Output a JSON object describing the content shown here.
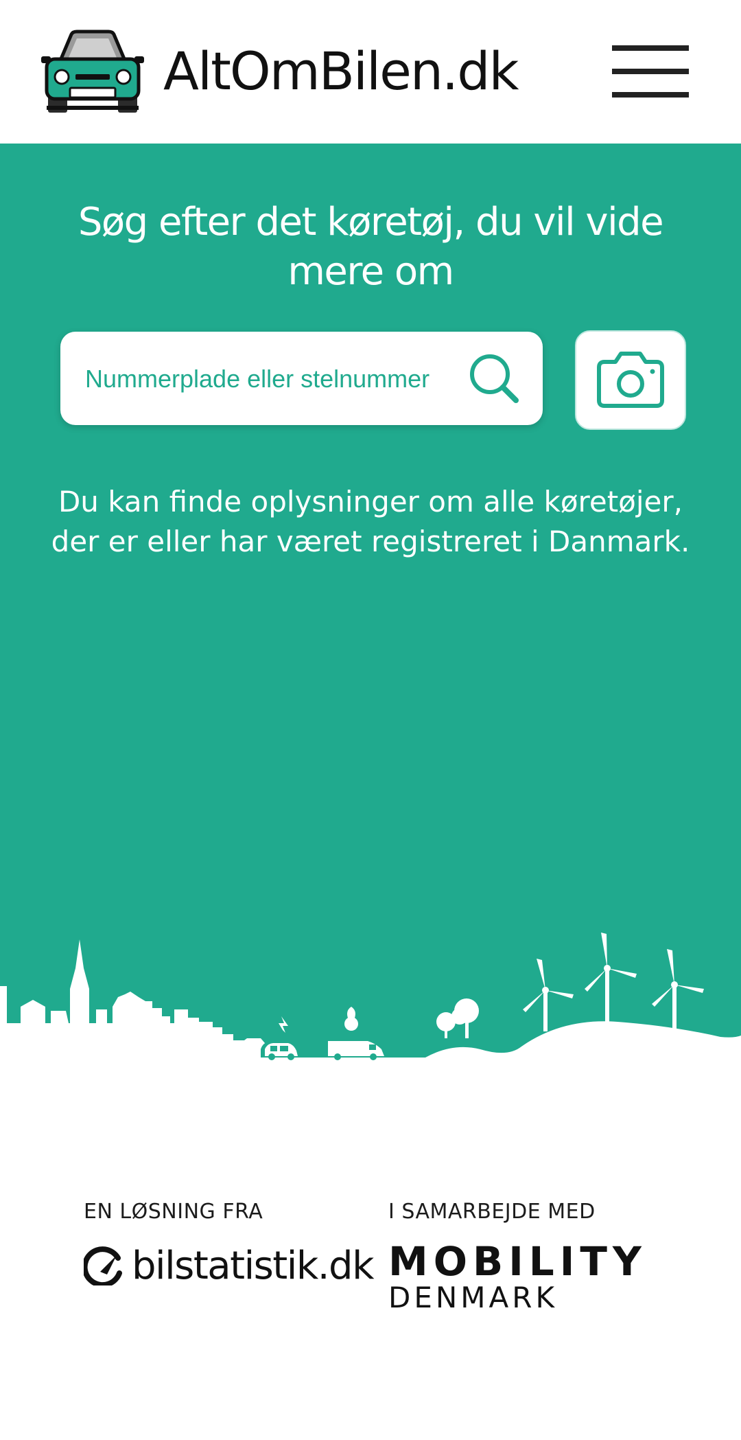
{
  "header": {
    "brand": "AltOmBilen.dk",
    "menu_icon": "hamburger-menu-icon",
    "logo_icon": "car-front-icon"
  },
  "hero": {
    "headline": "Søg efter det køretøj, du vil vide mere om",
    "search": {
      "placeholder": "Nummerplade eller stelnummer",
      "value": "",
      "icon": "search-icon"
    },
    "camera_icon": "camera-icon",
    "info_text": "Du kan finde oplysninger om alle køretøjer, der er eller har været registreret i Danmark."
  },
  "footer": {
    "solution_label": "EN LØSNING FRA",
    "solution_logo": "bilstatistik.dk",
    "partner_label": "I SAMARBEJDE MED",
    "partner_logo_line1": "MOBILITY",
    "partner_logo_line2": "DENMARK"
  },
  "colors": {
    "accent": "#20aa8e",
    "text_dark": "#111111",
    "background": "#ffffff"
  }
}
